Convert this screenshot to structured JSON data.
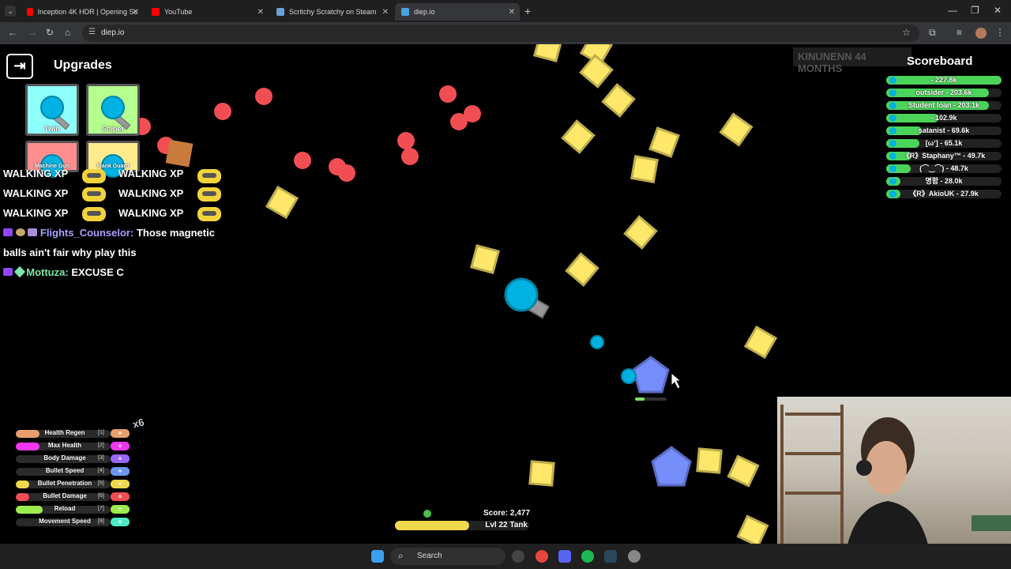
{
  "browser": {
    "tabs": [
      {
        "title": "Inception 4K HDR | Opening Sc",
        "active": false,
        "favicon_color": "#ff0000"
      },
      {
        "title": "YouTube",
        "active": false,
        "favicon_color": "#ff0000"
      },
      {
        "title": "Scritchy Scratchy on Steam",
        "active": false,
        "favicon_color": "#6aa0d8"
      },
      {
        "title": "diep.io",
        "active": true,
        "favicon_color": "#4aa3df"
      }
    ],
    "url": "diep.io",
    "new_tab_glyph": "+",
    "close_glyph": "✕"
  },
  "upgrades": {
    "title": "Upgrades",
    "exit_glyph": "⇥",
    "cards": [
      {
        "label": "Twin",
        "color": "#8efffb"
      },
      {
        "label": "Sniper",
        "color": "#b4ff8e"
      },
      {
        "label": "Machine Gun",
        "color": "#ff8e8e"
      },
      {
        "label": "Flank Guard",
        "color": "#ffeb8e"
      }
    ]
  },
  "chat": {
    "walking": [
      "WALKING XP",
      "WALKING XP",
      "WALKING XP",
      "WALKING XP",
      "WALKING XP",
      "WALKING XP"
    ],
    "messages": [
      {
        "user": "Flights_Counselor:",
        "user_color": "#a9a0ff",
        "text": "Those magnetic",
        "text2": "balls ain't fair why play this"
      },
      {
        "user": "Mottuza:",
        "user_color": "#7ee8a8",
        "text": "EXCUSE C"
      }
    ]
  },
  "stats": {
    "points_badge": "x6",
    "rows": [
      {
        "name": "Health Regen",
        "key": "[1]",
        "color": "#e69f6c",
        "level_fraction": 0.25
      },
      {
        "name": "Max Health",
        "key": "[2]",
        "color": "#ee37ee",
        "level_fraction": 0.25
      },
      {
        "name": "Body Damage",
        "key": "[3]",
        "color": "#9a66ff",
        "level_fraction": 0.0
      },
      {
        "name": "Bullet Speed",
        "key": "[4]",
        "color": "#6c96f0",
        "level_fraction": 0.0
      },
      {
        "name": "Bullet Penetration",
        "key": "[5]",
        "color": "#f0d94c",
        "level_fraction": 0.14
      },
      {
        "name": "Bullet Damage",
        "key": "[6]",
        "color": "#f14e54",
        "level_fraction": 0.14
      },
      {
        "name": "Reload",
        "key": "[7]",
        "color": "#9cec4c",
        "level_fraction": 0.28
      },
      {
        "name": "Movement Speed",
        "key": "[8]",
        "color": "#4cecc3",
        "level_fraction": 0.0
      }
    ],
    "plus_glyph": "+"
  },
  "score": {
    "score_text": "Score: 2,477",
    "level_text": "Lvl 22 Tank",
    "level_progress": 0.55
  },
  "scoreboard": {
    "title": "Scoreboard",
    "faded_text": "KINUNENN  44 MONTHS",
    "rows": [
      {
        "text": "- 227.8k",
        "fraction": 1.0
      },
      {
        "text": "outsider - 203.6k",
        "fraction": 0.89
      },
      {
        "text": "Student loan - 203.1k",
        "fraction": 0.89
      },
      {
        "text": "- 102.9k",
        "fraction": 0.45
      },
      {
        "text": "satanist - 69.6k",
        "fraction": 0.31
      },
      {
        "text": "[ωʼ] - 65.1k",
        "fraction": 0.29
      },
      {
        "text": "《R》Staphany™ - 49.7k",
        "fraction": 0.22
      },
      {
        "text": "(⌒‿⌒) - 48.7k",
        "fraction": 0.21
      },
      {
        "text": "명함 - 28.0k",
        "fraction": 0.12
      },
      {
        "text": "《R》AkioUK - 27.9k",
        "fraction": 0.12
      }
    ]
  },
  "taskbar": {
    "search_label": "Search"
  },
  "colors": {
    "tank_blue": "#00b2e1",
    "square_yellow": "#ffe869",
    "triangle_red": "#f14e54",
    "pentagon_blue": "#768dfc"
  }
}
